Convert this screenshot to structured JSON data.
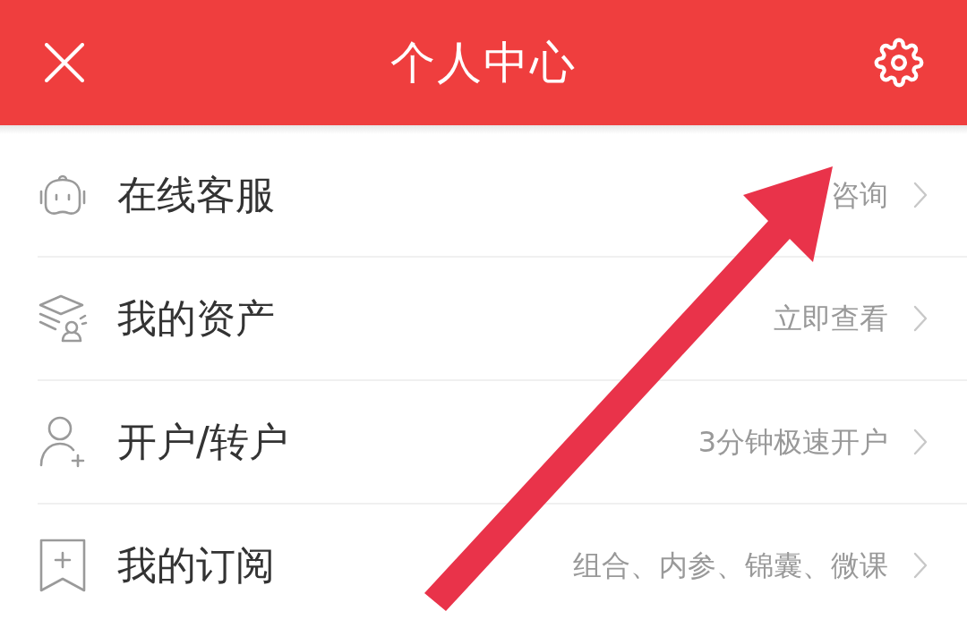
{
  "header": {
    "title": "个人中心"
  },
  "menu": [
    {
      "label": "在线客服",
      "detail": "咨询"
    },
    {
      "label": "我的资产",
      "detail": "立即查看"
    },
    {
      "label": "开户/转户",
      "detail": "3分钟极速开户"
    },
    {
      "label": "我的订阅",
      "detail": "组合、内参、锦囊、微课"
    }
  ]
}
